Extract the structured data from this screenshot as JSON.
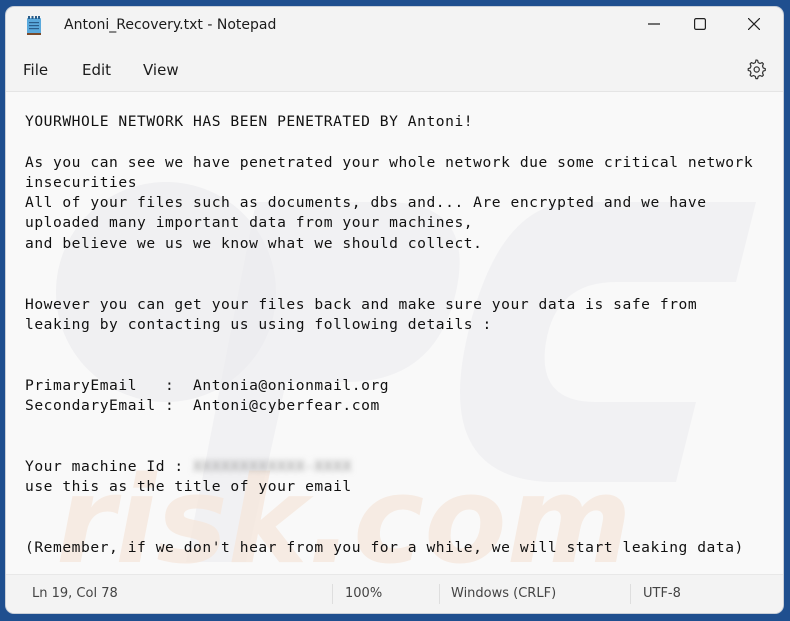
{
  "window": {
    "title": "Antoni_Recovery.txt - Notepad",
    "controls": [
      "minimize",
      "maximize",
      "close"
    ]
  },
  "menu": {
    "items": [
      "File",
      "Edit",
      "View"
    ],
    "settings_icon": "gear-icon"
  },
  "document": {
    "lines": [
      "YOURWHOLE NETWORK HAS BEEN PENETRATED BY Antoni!",
      "",
      "As you can see we have penetrated your whole network due some critical network",
      "insecurities",
      "All of your files such as documents, dbs and... Are encrypted and we have",
      "uploaded many important data from your machines,",
      "and believe we us we know what we should collect.",
      "",
      "",
      "However you can get your files back and make sure your data is safe from",
      "leaking by contacting us using following details :",
      "",
      "",
      "PrimaryEmail   :  Antonia@onionmail.org",
      "SecondaryEmail :  Antoni@cyberfear.com",
      "",
      "",
      "Your machine Id : ",
      "use this as the title of your email",
      "",
      "",
      "(Remember, if we don't hear from you for a while, we will start leaking data)"
    ],
    "machine_id_redacted": "XXXXXXXXXXXX-XXXX"
  },
  "statusbar": {
    "position": "Ln 19, Col 78",
    "zoom": "100%",
    "line_ending": "Windows (CRLF)",
    "encoding": "UTF-8"
  },
  "colors": {
    "desktop": "#1f4f8f",
    "window_bg": "#f3f3f3",
    "editor_bg": "#f9f9f9",
    "text": "#111111"
  }
}
